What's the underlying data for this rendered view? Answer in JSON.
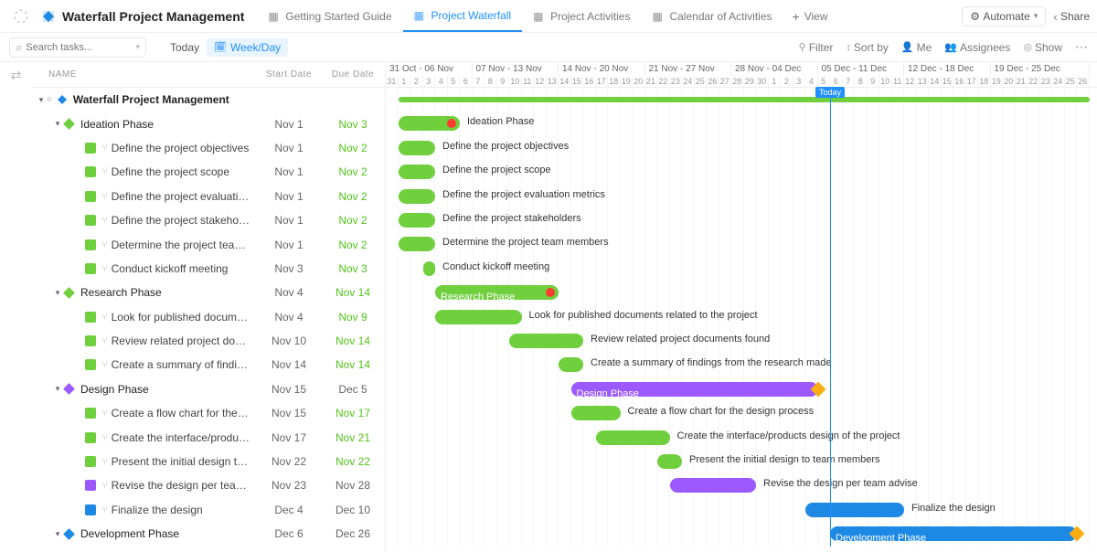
{
  "header": {
    "title": "Waterfall Project Management",
    "tabs": [
      {
        "label": "Getting Started Guide",
        "active": false,
        "icon": "doc-icon"
      },
      {
        "label": "Project Waterfall",
        "active": true,
        "icon": "gantt-icon"
      },
      {
        "label": "Project Activities",
        "active": false,
        "icon": "list-icon"
      },
      {
        "label": "Calendar of Activities",
        "active": false,
        "icon": "calendar-icon"
      }
    ],
    "add_view": "View",
    "automate": "Automate",
    "share": "Share"
  },
  "toolbar": {
    "search_placeholder": "Search tasks...",
    "today": "Today",
    "week_day": "Week/Day",
    "filter": "Filter",
    "sort_by": "Sort by",
    "me": "Me",
    "assignees": "Assignees",
    "show": "Show"
  },
  "list_head": {
    "name": "NAME",
    "start": "Start Date",
    "due": "Due Date"
  },
  "timeline": {
    "today_label": "Today",
    "day_width": 13.5,
    "start_day_index": 0,
    "today_index": 36,
    "weeks": [
      {
        "label": "31 Oct - 06 Nov",
        "days": [
          "31",
          "1",
          "2",
          "3",
          "4",
          "5",
          "6"
        ]
      },
      {
        "label": "07 Nov - 13 Nov",
        "days": [
          "7",
          "8",
          "9",
          "10",
          "11",
          "12",
          "13"
        ]
      },
      {
        "label": "14 Nov - 20 Nov",
        "days": [
          "14",
          "15",
          "16",
          "17",
          "18",
          "19",
          "20"
        ]
      },
      {
        "label": "21 Nov - 27 Nov",
        "days": [
          "21",
          "22",
          "23",
          "24",
          "25",
          "26",
          "27"
        ]
      },
      {
        "label": "28 Nov - 04 Dec",
        "days": [
          "28",
          "29",
          "30",
          "1",
          "2",
          "3",
          "4"
        ]
      },
      {
        "label": "05 Dec - 11 Dec",
        "days": [
          "5",
          "6",
          "7",
          "8",
          "9",
          "10",
          "11"
        ]
      },
      {
        "label": "12 Dec - 18 Dec",
        "days": [
          "12",
          "13",
          "14",
          "15",
          "16",
          "17",
          "18"
        ]
      },
      {
        "label": "19 Dec - 25 Dec",
        "days": [
          "19",
          "20",
          "21",
          "22",
          "23",
          "24",
          "25",
          "26"
        ]
      }
    ]
  },
  "colors": {
    "green": "#6fcf3d",
    "purple": "#9b59ff",
    "blue": "#1e88e5",
    "orange": "#faad14"
  },
  "rows": [
    {
      "type": "project",
      "name": "Waterfall Project Management",
      "start": "",
      "due": "",
      "depth": 0,
      "bar": {
        "start": 1,
        "end": 56,
        "color": "green",
        "slim": true,
        "extend": true
      }
    },
    {
      "type": "phase",
      "name": "Ideation Phase",
      "start": "Nov 1",
      "due": "Nov 3",
      "due_green": true,
      "depth": 1,
      "bullet": "green",
      "diamond": true,
      "bar": {
        "start": 1,
        "end": 6,
        "color": "green"
      },
      "label_out": "Ideation Phase",
      "late_dot": true
    },
    {
      "type": "task",
      "name": "Define the project objectives",
      "start": "Nov 1",
      "due": "Nov 2",
      "due_green": true,
      "depth": 2,
      "bullet": "green",
      "bar": {
        "start": 1,
        "end": 4,
        "color": "green"
      },
      "label_out": "Define the project objectives"
    },
    {
      "type": "task",
      "name": "Define the project scope",
      "start": "Nov 1",
      "due": "Nov 2",
      "due_green": true,
      "depth": 2,
      "bullet": "green",
      "bar": {
        "start": 1,
        "end": 4,
        "color": "green"
      },
      "label_out": "Define the project scope"
    },
    {
      "type": "task",
      "name": "Define the project evaluation...",
      "start": "Nov 1",
      "due": "Nov 2",
      "due_green": true,
      "depth": 2,
      "bullet": "green",
      "bar": {
        "start": 1,
        "end": 4,
        "color": "green"
      },
      "label_out": "Define the project evaluation metrics"
    },
    {
      "type": "task",
      "name": "Define the project stakehold...",
      "start": "Nov 1",
      "due": "Nov 2",
      "due_green": true,
      "depth": 2,
      "bullet": "green",
      "bar": {
        "start": 1,
        "end": 4,
        "color": "green"
      },
      "label_out": "Define the project stakeholders"
    },
    {
      "type": "task",
      "name": "Determine the project team ...",
      "start": "Nov 1",
      "due": "Nov 2",
      "due_green": true,
      "depth": 2,
      "bullet": "green",
      "bar": {
        "start": 1,
        "end": 4,
        "color": "green"
      },
      "label_out": "Determine the project team members"
    },
    {
      "type": "task",
      "name": "Conduct kickoff meeting",
      "start": "Nov 3",
      "due": "Nov 3",
      "due_green": true,
      "depth": 2,
      "bullet": "green",
      "bar": {
        "start": 3,
        "end": 4,
        "color": "green"
      },
      "label_out": "Conduct kickoff meeting"
    },
    {
      "type": "phase",
      "name": "Research Phase",
      "start": "Nov 4",
      "due": "Nov 14",
      "due_green": true,
      "depth": 1,
      "bullet": "green",
      "diamond": true,
      "bar": {
        "start": 4,
        "end": 14,
        "color": "green"
      },
      "label_in": "Research Phase",
      "late_dot": true
    },
    {
      "type": "task",
      "name": "Look for published documen...",
      "start": "Nov 4",
      "due": "Nov 9",
      "due_green": true,
      "depth": 2,
      "bullet": "green",
      "bar": {
        "start": 4,
        "end": 11,
        "color": "green"
      },
      "label_out": "Look for published documents related to the project"
    },
    {
      "type": "task",
      "name": "Review related project docu...",
      "start": "Nov 10",
      "due": "Nov 14",
      "due_green": true,
      "depth": 2,
      "bullet": "green",
      "bar": {
        "start": 10,
        "end": 16,
        "color": "green"
      },
      "label_out": "Review related project documents found"
    },
    {
      "type": "task",
      "name": "Create a summary of finding...",
      "start": "Nov 14",
      "due": "Nov 14",
      "due_green": true,
      "depth": 2,
      "bullet": "green",
      "bar": {
        "start": 14,
        "end": 16,
        "color": "green"
      },
      "label_out": "Create a summary of findings from the research made"
    },
    {
      "type": "phase",
      "name": "Design Phase",
      "start": "Nov 15",
      "due": "Dec 5",
      "due_green": false,
      "depth": 1,
      "bullet": "purple",
      "diamond": true,
      "bar": {
        "start": 15,
        "end": 35,
        "color": "purple"
      },
      "label_in": "Design Phase",
      "diamond_end": "orange"
    },
    {
      "type": "task",
      "name": "Create a flow chart for the d...",
      "start": "Nov 15",
      "due": "Nov 17",
      "due_green": true,
      "depth": 2,
      "bullet": "green",
      "bar": {
        "start": 15,
        "end": 19,
        "color": "green"
      },
      "label_out": "Create a flow chart for the design process"
    },
    {
      "type": "task",
      "name": "Create the interface/product...",
      "start": "Nov 17",
      "due": "Nov 21",
      "due_green": true,
      "depth": 2,
      "bullet": "green",
      "bar": {
        "start": 17,
        "end": 23,
        "color": "green"
      },
      "label_out": "Create the interface/products design of the project"
    },
    {
      "type": "task",
      "name": "Present the initial design to t...",
      "start": "Nov 22",
      "due": "Nov 22",
      "due_green": true,
      "depth": 2,
      "bullet": "green",
      "bar": {
        "start": 22,
        "end": 24,
        "color": "green"
      },
      "label_out": "Present the initial design to team members"
    },
    {
      "type": "task",
      "name": "Revise the design per team a...",
      "start": "Nov 23",
      "due": "Nov 28",
      "due_green": false,
      "depth": 2,
      "bullet": "purple",
      "bar": {
        "start": 23,
        "end": 30,
        "color": "purple"
      },
      "label_out": "Revise the design per team advise"
    },
    {
      "type": "task",
      "name": "Finalize the design",
      "start": "Dec 4",
      "due": "Dec 10",
      "due_green": false,
      "depth": 2,
      "bullet": "blue",
      "bar": {
        "start": 34,
        "end": 42,
        "color": "blue"
      },
      "label_out": "Finalize the design"
    },
    {
      "type": "phase",
      "name": "Development Phase",
      "start": "Dec 6",
      "due": "Dec 26",
      "due_green": false,
      "depth": 1,
      "bullet": "blue",
      "diamond": true,
      "bar": {
        "start": 36,
        "end": 56,
        "color": "blue"
      },
      "label_in": "Development Phase",
      "diamond_end": "orange"
    }
  ]
}
